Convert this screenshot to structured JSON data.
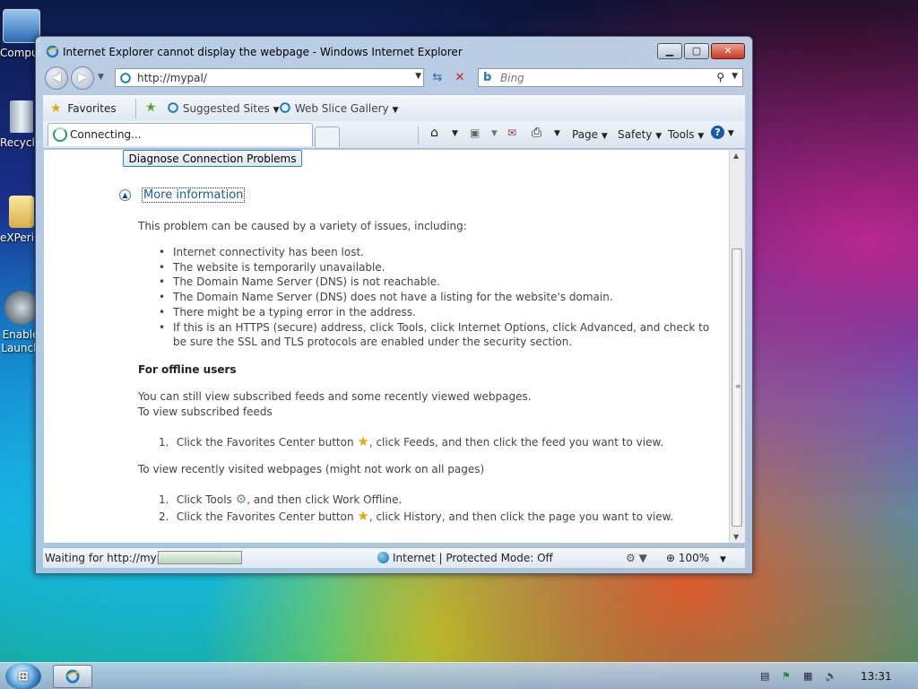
{
  "desktop": {
    "icons": [
      {
        "label": "Computer"
      },
      {
        "label": "Recycle Bin"
      },
      {
        "label": "eXPerience"
      },
      {
        "label": "Enable Launch"
      }
    ]
  },
  "window": {
    "title": "Internet Explorer cannot display the webpage - Windows Internet Explorer",
    "address": "http://mypal/",
    "search_placeholder": "Bing",
    "favorites": {
      "favorites_label": "Favorites",
      "suggested_sites_label": "Suggested Sites",
      "web_slice_gallery_label": "Web Slice Gallery"
    },
    "tab": {
      "label": "Connecting..."
    },
    "commands": {
      "page_label": "Page",
      "safety_label": "Safety",
      "tools_label": "Tools"
    }
  },
  "content": {
    "diagnose_button": "Diagnose Connection Problems",
    "more_info_link": "More information",
    "intro": "This problem can be caused by a variety of issues, including:",
    "bullets": [
      "Internet connectivity has been lost.",
      "The website is temporarily unavailable.",
      "The Domain Name Server (DNS) is not reachable.",
      "The Domain Name Server (DNS) does not have a listing for the website's domain.",
      "There might be a typing error in the address.",
      "If this is an HTTPS (secure) address, click Tools, click Internet Options, click Advanced, and check to be sure the SSL and TLS protocols are enabled under the security section."
    ],
    "offline_heading": "For offline users",
    "offline_text_1": "You can still view subscribed feeds and some recently viewed webpages.",
    "offline_text_2": "To view subscribed feeds",
    "feeds_step_1_num": "1.",
    "feeds_step_1_a": "Click the Favorites Center button",
    "feeds_step_1_b": ", click Feeds, and then click the feed you want to view.",
    "recent_heading": "To view recently visited webpages (might not work on all pages)",
    "recent_step_1_num": "1.",
    "recent_step_1_a": "Click Tools",
    "recent_step_1_b": ", and then click Work Offline.",
    "recent_step_2_num": "2.",
    "recent_step_2_a": "Click the Favorites Center button",
    "recent_step_2_b": ", click History, and then click the page you want to view."
  },
  "status": {
    "text": "Waiting for http://myp",
    "progress": 0.98,
    "zone": "Internet | Protected Mode: Off",
    "zoom": "100%"
  },
  "taskbar": {
    "clock": "13:31"
  }
}
